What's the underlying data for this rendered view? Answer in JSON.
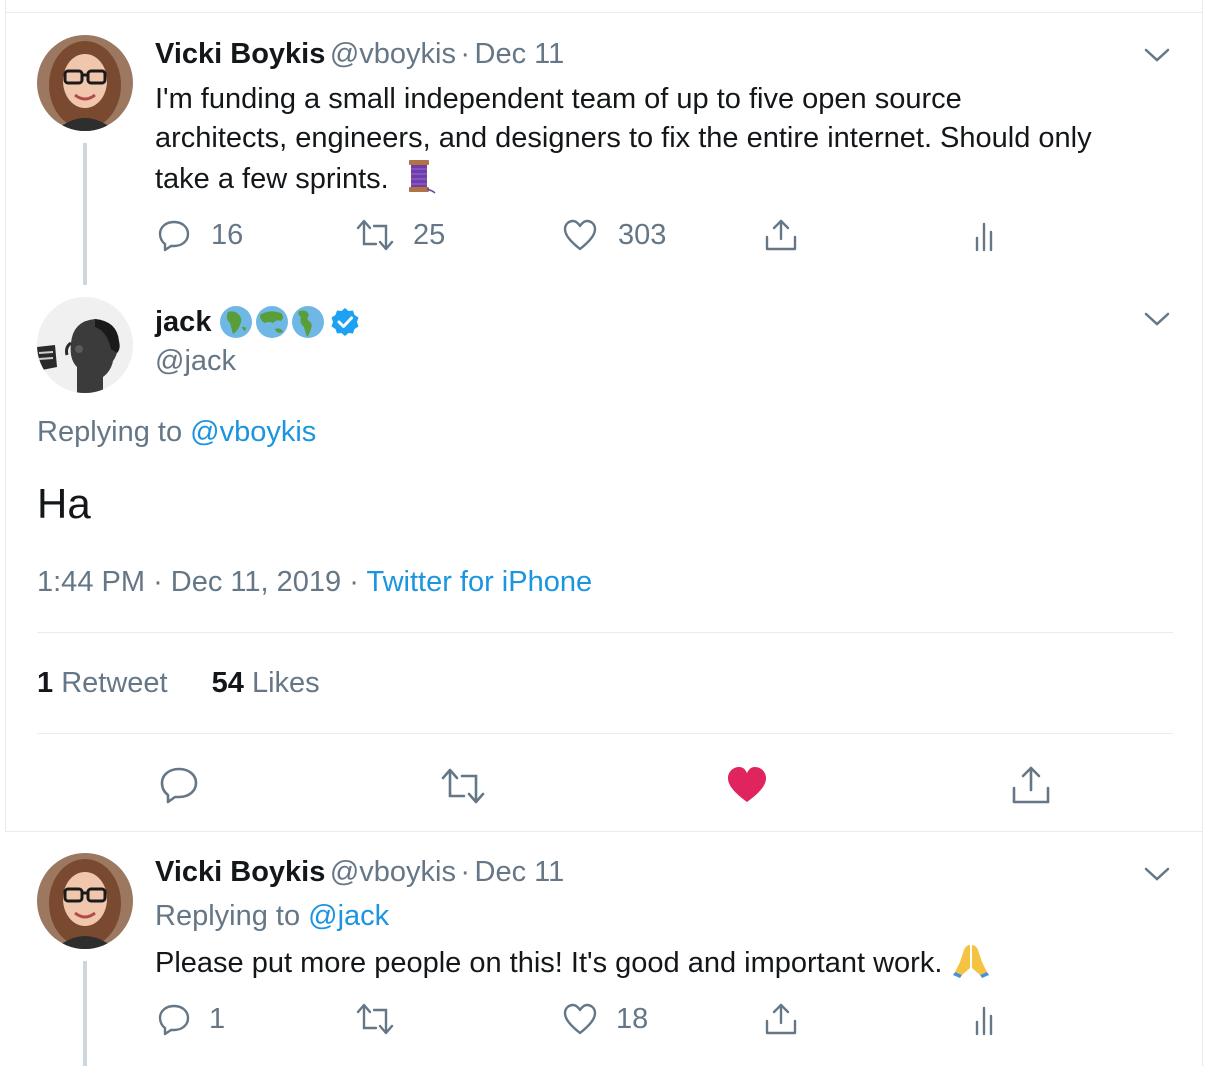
{
  "tweets": [
    {
      "name": "Vicki Boykis",
      "handle": "@vboykis",
      "separator": "·",
      "date": "Dec 11",
      "text": "I'm funding a small independent team of up to five open source architects, engineers, and designers to fix the entire internet. Should only take a few sprints.",
      "lines": [
        "I'm funding a small independent team of up to five open source",
        "architects, engineers, and designers to fix the entire internet. Should only",
        "take a few sprints."
      ],
      "emoji": "spool-of-thread",
      "replies": "16",
      "retweets": "25",
      "likes": "303"
    },
    {
      "name": "Vicki Boykis",
      "handle": "@vboykis",
      "separator": "·",
      "date": "Dec 11",
      "replying_label": "Replying to",
      "replying_to": "@jack",
      "text": "Please put more people on this! It's good and important work.",
      "emoji": "folded-hands",
      "replies": "1",
      "retweets": "",
      "likes": "18"
    }
  ],
  "main_tweet": {
    "name": "jack",
    "name_emojis": [
      "globe-africa",
      "globe-asia",
      "globe-americas"
    ],
    "verified": true,
    "handle": "@jack",
    "replying_label": "Replying to",
    "replying_to": "@vboykis",
    "text": "Ha",
    "time": "1:44 PM",
    "separator": "·",
    "date": "Dec 11, 2019",
    "separator2": "·",
    "source": "Twitter for iPhone",
    "retweet_count": "1",
    "retweet_label": "Retweet",
    "like_count": "54",
    "like_label": "Likes",
    "liked": true
  },
  "colors": {
    "link": "#1b95e0",
    "muted": "#657786",
    "text": "#14171a",
    "like_red": "#e0245e",
    "border": "#e6ecf0",
    "verified": "#1da1f2"
  }
}
